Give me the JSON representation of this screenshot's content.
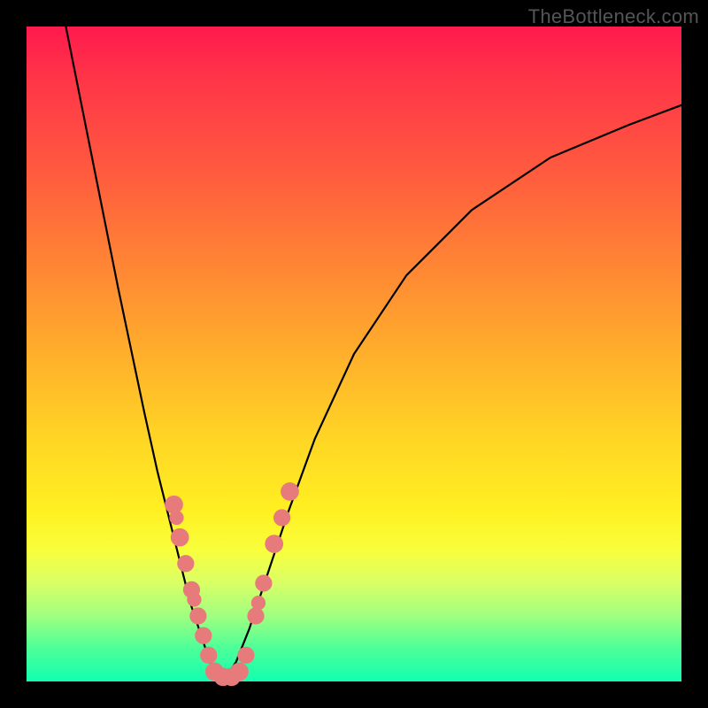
{
  "watermark": "TheBottleneck.com",
  "chart_data": {
    "type": "line",
    "title": "",
    "xlabel": "",
    "ylabel": "",
    "xlim": [
      0,
      100
    ],
    "ylim": [
      0,
      100
    ],
    "grid": false,
    "legend": false,
    "series": [
      {
        "name": "curve-left-branch",
        "color": "#000000",
        "x": [
          6,
          10,
          14,
          18,
          20,
          22,
          23,
          24,
          25,
          26,
          27,
          28,
          29,
          30
        ],
        "y": [
          100,
          80,
          60,
          41,
          32,
          24,
          20,
          16,
          12,
          9,
          6,
          3,
          1,
          0
        ]
      },
      {
        "name": "curve-right-branch",
        "color": "#000000",
        "x": [
          30,
          32,
          34,
          36,
          38,
          40,
          44,
          50,
          58,
          68,
          80,
          92,
          100
        ],
        "y": [
          0,
          3,
          8,
          14,
          20,
          26,
          37,
          50,
          62,
          72,
          80,
          85,
          88
        ]
      }
    ],
    "annotations": [
      {
        "name": "marker",
        "x": 22.5,
        "y": 27,
        "r": 1.4,
        "color": "#e77a7a"
      },
      {
        "name": "marker",
        "x": 22.9,
        "y": 25,
        "r": 1.1,
        "color": "#e77a7a"
      },
      {
        "name": "marker",
        "x": 23.4,
        "y": 22,
        "r": 1.4,
        "color": "#e77a7a"
      },
      {
        "name": "marker",
        "x": 24.3,
        "y": 18,
        "r": 1.3,
        "color": "#e77a7a"
      },
      {
        "name": "marker",
        "x": 25.2,
        "y": 14,
        "r": 1.3,
        "color": "#e77a7a"
      },
      {
        "name": "marker",
        "x": 25.6,
        "y": 12.5,
        "r": 1.1,
        "color": "#e77a7a"
      },
      {
        "name": "marker",
        "x": 26.2,
        "y": 10,
        "r": 1.3,
        "color": "#e77a7a"
      },
      {
        "name": "marker",
        "x": 27.0,
        "y": 7,
        "r": 1.3,
        "color": "#e77a7a"
      },
      {
        "name": "marker",
        "x": 27.8,
        "y": 4,
        "r": 1.3,
        "color": "#e77a7a"
      },
      {
        "name": "marker",
        "x": 28.7,
        "y": 1.5,
        "r": 1.4,
        "color": "#e77a7a"
      },
      {
        "name": "marker",
        "x": 30.0,
        "y": 0.7,
        "r": 1.4,
        "color": "#e77a7a"
      },
      {
        "name": "marker",
        "x": 31.3,
        "y": 0.7,
        "r": 1.4,
        "color": "#e77a7a"
      },
      {
        "name": "marker",
        "x": 32.5,
        "y": 1.5,
        "r": 1.4,
        "color": "#e77a7a"
      },
      {
        "name": "marker",
        "x": 33.5,
        "y": 4,
        "r": 1.3,
        "color": "#e77a7a"
      },
      {
        "name": "marker",
        "x": 35.0,
        "y": 10,
        "r": 1.3,
        "color": "#e77a7a"
      },
      {
        "name": "marker",
        "x": 35.4,
        "y": 12,
        "r": 1.1,
        "color": "#e77a7a"
      },
      {
        "name": "marker",
        "x": 36.2,
        "y": 15,
        "r": 1.3,
        "color": "#e77a7a"
      },
      {
        "name": "marker",
        "x": 37.8,
        "y": 21,
        "r": 1.4,
        "color": "#e77a7a"
      },
      {
        "name": "marker",
        "x": 39.0,
        "y": 25,
        "r": 1.3,
        "color": "#e77a7a"
      },
      {
        "name": "marker",
        "x": 40.2,
        "y": 29,
        "r": 1.4,
        "color": "#e77a7a"
      }
    ]
  }
}
